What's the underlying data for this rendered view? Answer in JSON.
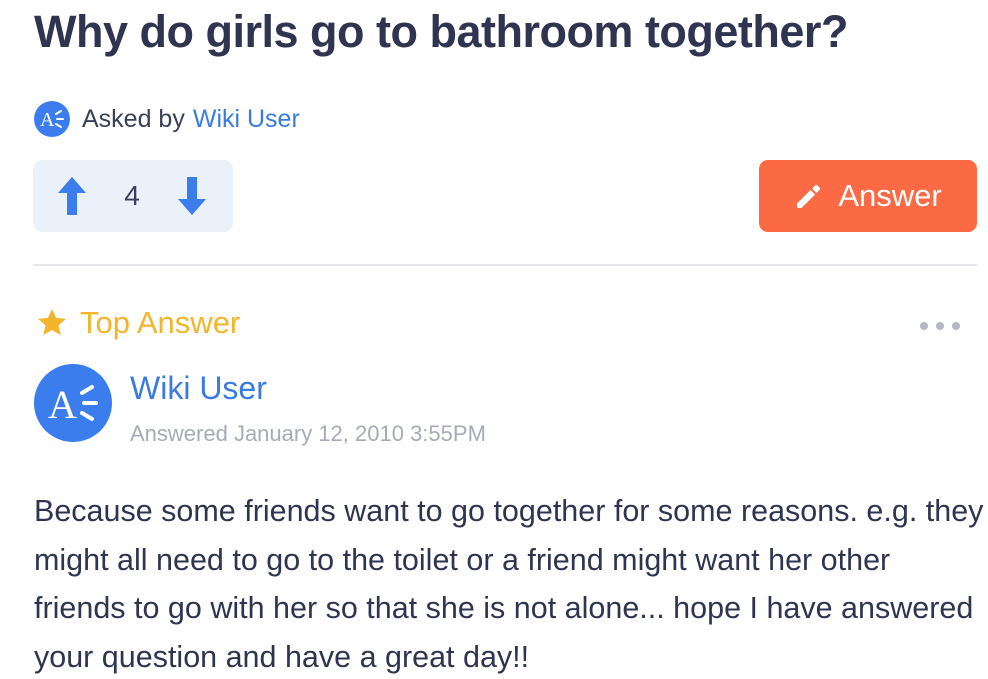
{
  "question": {
    "title": "Why do girls go to bathroom together?",
    "asked_by_label": "Asked by",
    "asked_by_user": "Wiki User"
  },
  "votes": {
    "count": "4",
    "upvote_icon": "arrow-up-icon",
    "downvote_icon": "arrow-down-icon"
  },
  "answer_button": {
    "label": "Answer",
    "icon": "pencil-icon"
  },
  "top_answer": {
    "label": "Top Answer",
    "icon": "star-icon",
    "author": "Wiki User",
    "answered_date": "Answered January 12, 2010 3:55PM",
    "text": "Because some friends want to go together for some reasons. e.g. they might all need to go to the toilet or a friend might want her other friends to go with her so that she is not alone... hope I have answered your question and have a great day!!"
  },
  "colors": {
    "brand_blue": "#3b7ded",
    "link_blue": "#3a7be0",
    "answer_orange": "#fb6a44",
    "star_yellow": "#f3b52b",
    "vote_bg": "#eaf1fb"
  }
}
